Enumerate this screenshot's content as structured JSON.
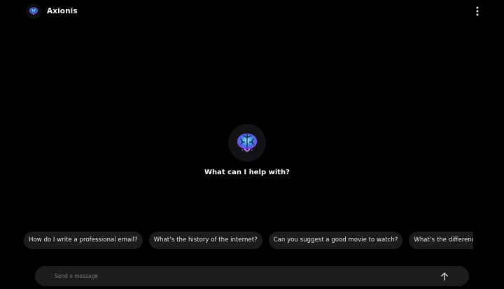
{
  "header": {
    "app_name": "Axionis",
    "logo_icon": "brain-logo-icon",
    "menu_icon": "more-vertical-icon"
  },
  "hero": {
    "logo_icon": "brain-logo-icon",
    "headline": "What can I help with?"
  },
  "suggestions": [
    "How do I write a professional email?",
    "What’s the history of the internet?",
    "Can you suggest a good movie to watch?",
    "What’s the difference between"
  ],
  "composer": {
    "placeholder": "Send a message",
    "send_icon": "arrow-up-icon"
  },
  "colors": {
    "background": "#000000",
    "surface": "#1c1c1f",
    "text": "#ffffff",
    "brain_glow": "#4aa3ff"
  }
}
